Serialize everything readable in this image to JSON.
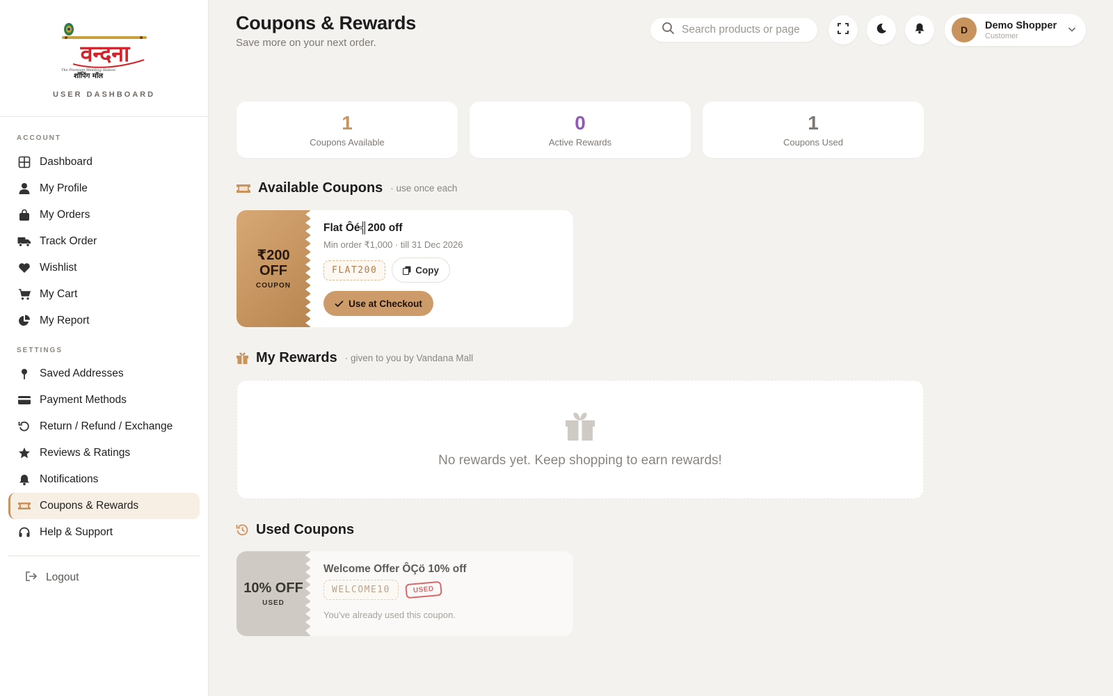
{
  "brand": {
    "logo_text": "वन्दना",
    "logo_tagline": "The Premium Wedding Station",
    "logo_sub": "शॉपिंग मॉल",
    "subtitle": "USER DASHBOARD"
  },
  "sidebar": {
    "account_title": "ACCOUNT",
    "account_items": [
      {
        "label": "Dashboard",
        "icon": "grid-icon"
      },
      {
        "label": "My Profile",
        "icon": "user-icon"
      },
      {
        "label": "My Orders",
        "icon": "bag-icon"
      },
      {
        "label": "Track Order",
        "icon": "truck-icon"
      },
      {
        "label": "Wishlist",
        "icon": "heart-icon"
      },
      {
        "label": "My Cart",
        "icon": "cart-icon"
      },
      {
        "label": "My Report",
        "icon": "pie-chart-icon"
      }
    ],
    "settings_title": "SETTINGS",
    "settings_items": [
      {
        "label": "Saved Addresses",
        "icon": "pin-icon"
      },
      {
        "label": "Payment Methods",
        "icon": "card-icon"
      },
      {
        "label": "Return / Refund / Exchange",
        "icon": "undo-icon"
      },
      {
        "label": "Reviews & Ratings",
        "icon": "star-icon"
      },
      {
        "label": "Notifications",
        "icon": "bell-icon"
      },
      {
        "label": "Coupons & Rewards",
        "icon": "ticket-icon",
        "active": true
      },
      {
        "label": "Help & Support",
        "icon": "headset-icon"
      }
    ],
    "logout_label": "Logout"
  },
  "header": {
    "title": "Coupons & Rewards",
    "subtitle": "Save more on your next order.",
    "search_placeholder": "Search products or page",
    "user_name": "Demo Shopper",
    "user_role": "Customer",
    "avatar_initial": "D"
  },
  "stats": [
    {
      "value": "1",
      "label": "Coupons Available",
      "color": "#c9935e"
    },
    {
      "value": "0",
      "label": "Active Rewards",
      "color": "#8e5bb8"
    },
    {
      "value": "1",
      "label": "Coupons Used",
      "color": "#7d7873"
    }
  ],
  "available": {
    "title": "Available Coupons",
    "note": "· use once each",
    "coupon": {
      "badge_big_1": "₹200",
      "badge_big_2": "OFF",
      "badge_small": "COUPON",
      "title": "Flat Ôé╣200 off",
      "meta": "Min order ₹1,000 · till 31 Dec 2026",
      "code": "FLAT200",
      "copy_label": "Copy",
      "checkout_label": "Use at Checkout"
    }
  },
  "rewards": {
    "title": "My Rewards",
    "note": "· given to you by Vandana Mall",
    "empty_message": "No rewards yet. Keep shopping to earn rewards!"
  },
  "used": {
    "title": "Used Coupons",
    "coupon": {
      "badge_big": "10% OFF",
      "badge_small": "USED",
      "title": "Welcome Offer ÔÇö 10% off",
      "code": "WELCOME10",
      "stamp": "USED",
      "note": "You've already used this coupon."
    }
  },
  "colors": {
    "accent": "#c9935e",
    "active_bg": "#f8efe4",
    "page_bg": "#f4f2ef",
    "used_red": "#d9686b"
  }
}
